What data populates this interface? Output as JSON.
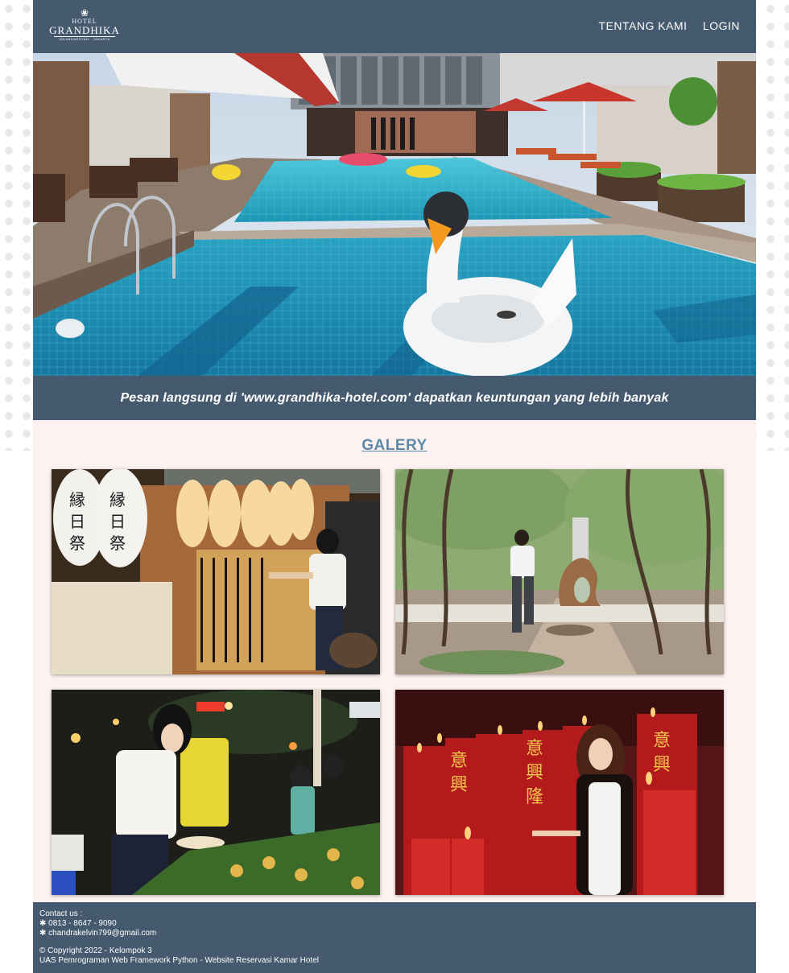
{
  "header": {
    "logo": {
      "line1": "HOTEL",
      "line2": "GRANDHIKA",
      "line3": "ISKANDARSYAH · JAKARTA"
    },
    "nav": [
      "TENTANG KAMI",
      "LOGIN"
    ]
  },
  "banner": {
    "text": "Pesan langsung di 'www.grandhika-hotel.com' dapatkan keuntungan yang lebih banyak"
  },
  "gallery": {
    "title": "GALERY",
    "photos": [
      {
        "alt": "Woman at Japanese lantern wall"
      },
      {
        "alt": "Woman walking in park with sculpture"
      },
      {
        "alt": "Woman at night market food stall"
      },
      {
        "alt": "Woman among red candles"
      }
    ]
  },
  "footer": {
    "contact_label": "Contact us :",
    "phone": "✱ 0813 - 8647 - 9090",
    "email": "✱ chandrakelvin799@gmail.com",
    "copyright": "© Copyright 2022 - Kelompok 3",
    "project": "UAS Pemrograman Web Framework Python - Website Reservasi Kamar Hotel"
  },
  "colors": {
    "header_bg": "#455a6f",
    "page_bg": "#fdf1f1",
    "gallery_title": "#5c8aa8"
  }
}
